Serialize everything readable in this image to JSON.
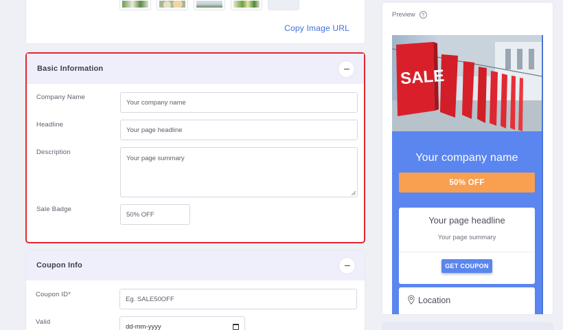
{
  "image_picker": {
    "copy_link": "Copy Image URL"
  },
  "basic_info": {
    "title": "Basic Information",
    "fields": {
      "company_name": {
        "label": "Company Name",
        "placeholder": "Your company name"
      },
      "headline": {
        "label": "Headline",
        "placeholder": "Your page headline"
      },
      "description": {
        "label": "Description",
        "placeholder": "Your page summary"
      },
      "sale_badge": {
        "label": "Sale Badge",
        "value": "50% OFF"
      }
    }
  },
  "coupon_info": {
    "title": "Coupon Info",
    "fields": {
      "coupon_id": {
        "label": "Coupon ID*",
        "placeholder": "Eg. SALE50OFF"
      },
      "valid": {
        "label": "Valid",
        "placeholder": "dd-mm-yyyy"
      }
    }
  },
  "preview": {
    "title": "Preview",
    "hero_text": "SALE",
    "company_name": "Your company name",
    "badge": "50% OFF",
    "headline": "Your page headline",
    "summary": "Your page summary",
    "coupon_button": "GET COUPON",
    "location": "Location"
  },
  "colors": {
    "accent_blue": "#5b86ef",
    "badge_orange": "#f8a04f",
    "highlight_red": "#e0262e",
    "section_header": "#efeffc"
  }
}
